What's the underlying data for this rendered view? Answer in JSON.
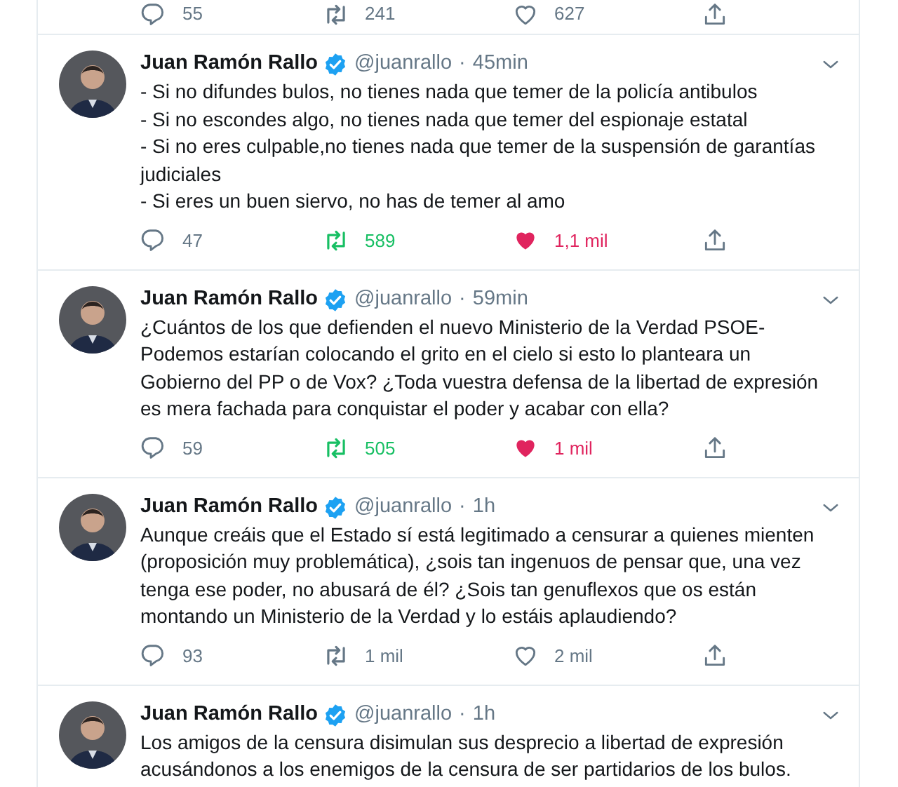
{
  "tweets": [
    {
      "replies": "55",
      "retweets": "241",
      "likes": "627",
      "retweeted": false,
      "liked": false
    },
    {
      "author": "Juan Ramón Rallo",
      "verified": true,
      "handle": "@juanrallo",
      "separator": "·",
      "time": "45min",
      "text": "- Si no difundes bulos, no tienes nada que temer de la policía antibulos\n- Si no escondes algo, no tienes nada que temer del espionaje estatal\n- Si no eres culpable,no tienes nada que temer de la suspensión de garantías judiciales\n- Si eres un buen siervo, no has de temer al amo",
      "replies": "47",
      "retweets": "589",
      "likes": "1,1 mil",
      "retweeted": true,
      "liked": true
    },
    {
      "author": "Juan Ramón Rallo",
      "verified": true,
      "handle": "@juanrallo",
      "separator": "·",
      "time": "59min",
      "text": "¿Cuántos de los que defienden el nuevo Ministerio de la Verdad PSOE-Podemos estarían colocando el grito en el cielo si esto lo planteara un Gobierno del PP o de Vox? ¿Toda vuestra defensa de la libertad de expresión es mera fachada para conquistar el poder y acabar con ella?",
      "replies": "59",
      "retweets": "505",
      "likes": "1 mil",
      "retweeted": true,
      "liked": true
    },
    {
      "author": "Juan Ramón Rallo",
      "verified": true,
      "handle": "@juanrallo",
      "separator": "·",
      "time": "1h",
      "text": "Aunque creáis que el Estado sí está legitimado a censurar a quienes mienten (proposición muy problemática), ¿sois tan ingenuos de pensar que, una vez tenga ese poder, no abusará de él? ¿Sois tan genuflexos que os están montando un Ministerio de la Verdad y lo estáis aplaudiendo?",
      "replies": "93",
      "retweets": "1 mil",
      "likes": "2 mil",
      "retweeted": false,
      "liked": false
    },
    {
      "author": "Juan Ramón Rallo",
      "verified": true,
      "handle": "@juanrallo",
      "separator": "·",
      "time": "1h",
      "text": "Los amigos de la censura disimulan sus desprecio a libertad de expresión acusándonos a los enemigos de la censura de ser partidarios de los bulos."
    }
  ]
}
